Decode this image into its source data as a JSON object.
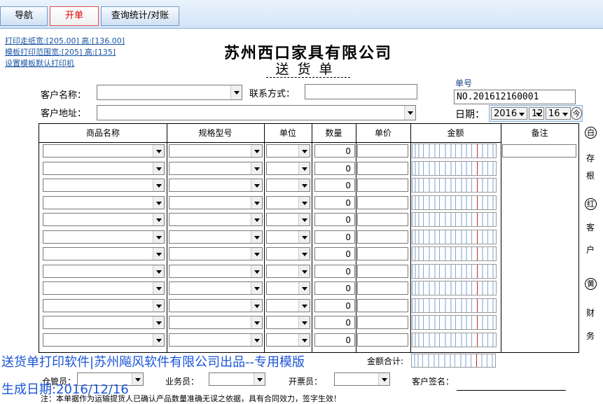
{
  "tabs": [
    {
      "label": "导航"
    },
    {
      "label": "开单"
    },
    {
      "label": "查询统计/对账"
    }
  ],
  "print_links": [
    "打印走纸宽:[205.00] 高:[136.00]",
    "模板打印范围宽:[205] 高:[135]",
    "设置模板默认打印机"
  ],
  "company_name": "苏州西口家具有限公司",
  "doc_title": "送货单",
  "customer": {
    "name_label": "客户名称：",
    "name_value": "",
    "contact_label": "联系方式：",
    "contact_value": "",
    "address_label": "客户地址：",
    "address_value": ""
  },
  "doc_number": {
    "label": "单号",
    "value": "NO.201612160001"
  },
  "date": {
    "label": "日期：",
    "year": "2016",
    "month": "12",
    "day": "16",
    "today_label": "今"
  },
  "table": {
    "headers": [
      "商品名称",
      "规格型号",
      "单位",
      "数量",
      "单价",
      "金额",
      "备注"
    ],
    "rows": [
      {
        "qty": "0"
      },
      {
        "qty": "0"
      },
      {
        "qty": "0"
      },
      {
        "qty": "0"
      },
      {
        "qty": "0"
      },
      {
        "qty": "0"
      },
      {
        "qty": "0"
      },
      {
        "qty": "0"
      },
      {
        "qty": "0"
      },
      {
        "qty": "0"
      },
      {
        "qty": "0"
      },
      {
        "qty": "0"
      }
    ]
  },
  "side_labels": {
    "white_circle": "白",
    "white_1": "存",
    "white_2": "根",
    "red_circle": "红",
    "red_1": "客",
    "red_2": "户",
    "yellow_circle": "黄",
    "yellow_1": "财",
    "yellow_2": "务"
  },
  "footer": {
    "total_label": "金额合计:",
    "warehouse_label": "仓管员：",
    "salesman_label": "业务员：",
    "invoicer_label": "开票员：",
    "customer_sign_label": "客户签名：",
    "note": "注：本单据作为运输提货人已确认产品数量准确无误之依据，具有合同效力，签字生效！"
  },
  "overlay": {
    "line1": "送货单打印软件|苏州飚风软件有限公司出品--专用模版",
    "line2": "生成日期:2016/12/16"
  },
  "colors": {
    "active_tab": "#e00000",
    "link": "#1a55a6",
    "overlay": "#1a55d9",
    "amount_marker": "#c0282c"
  }
}
